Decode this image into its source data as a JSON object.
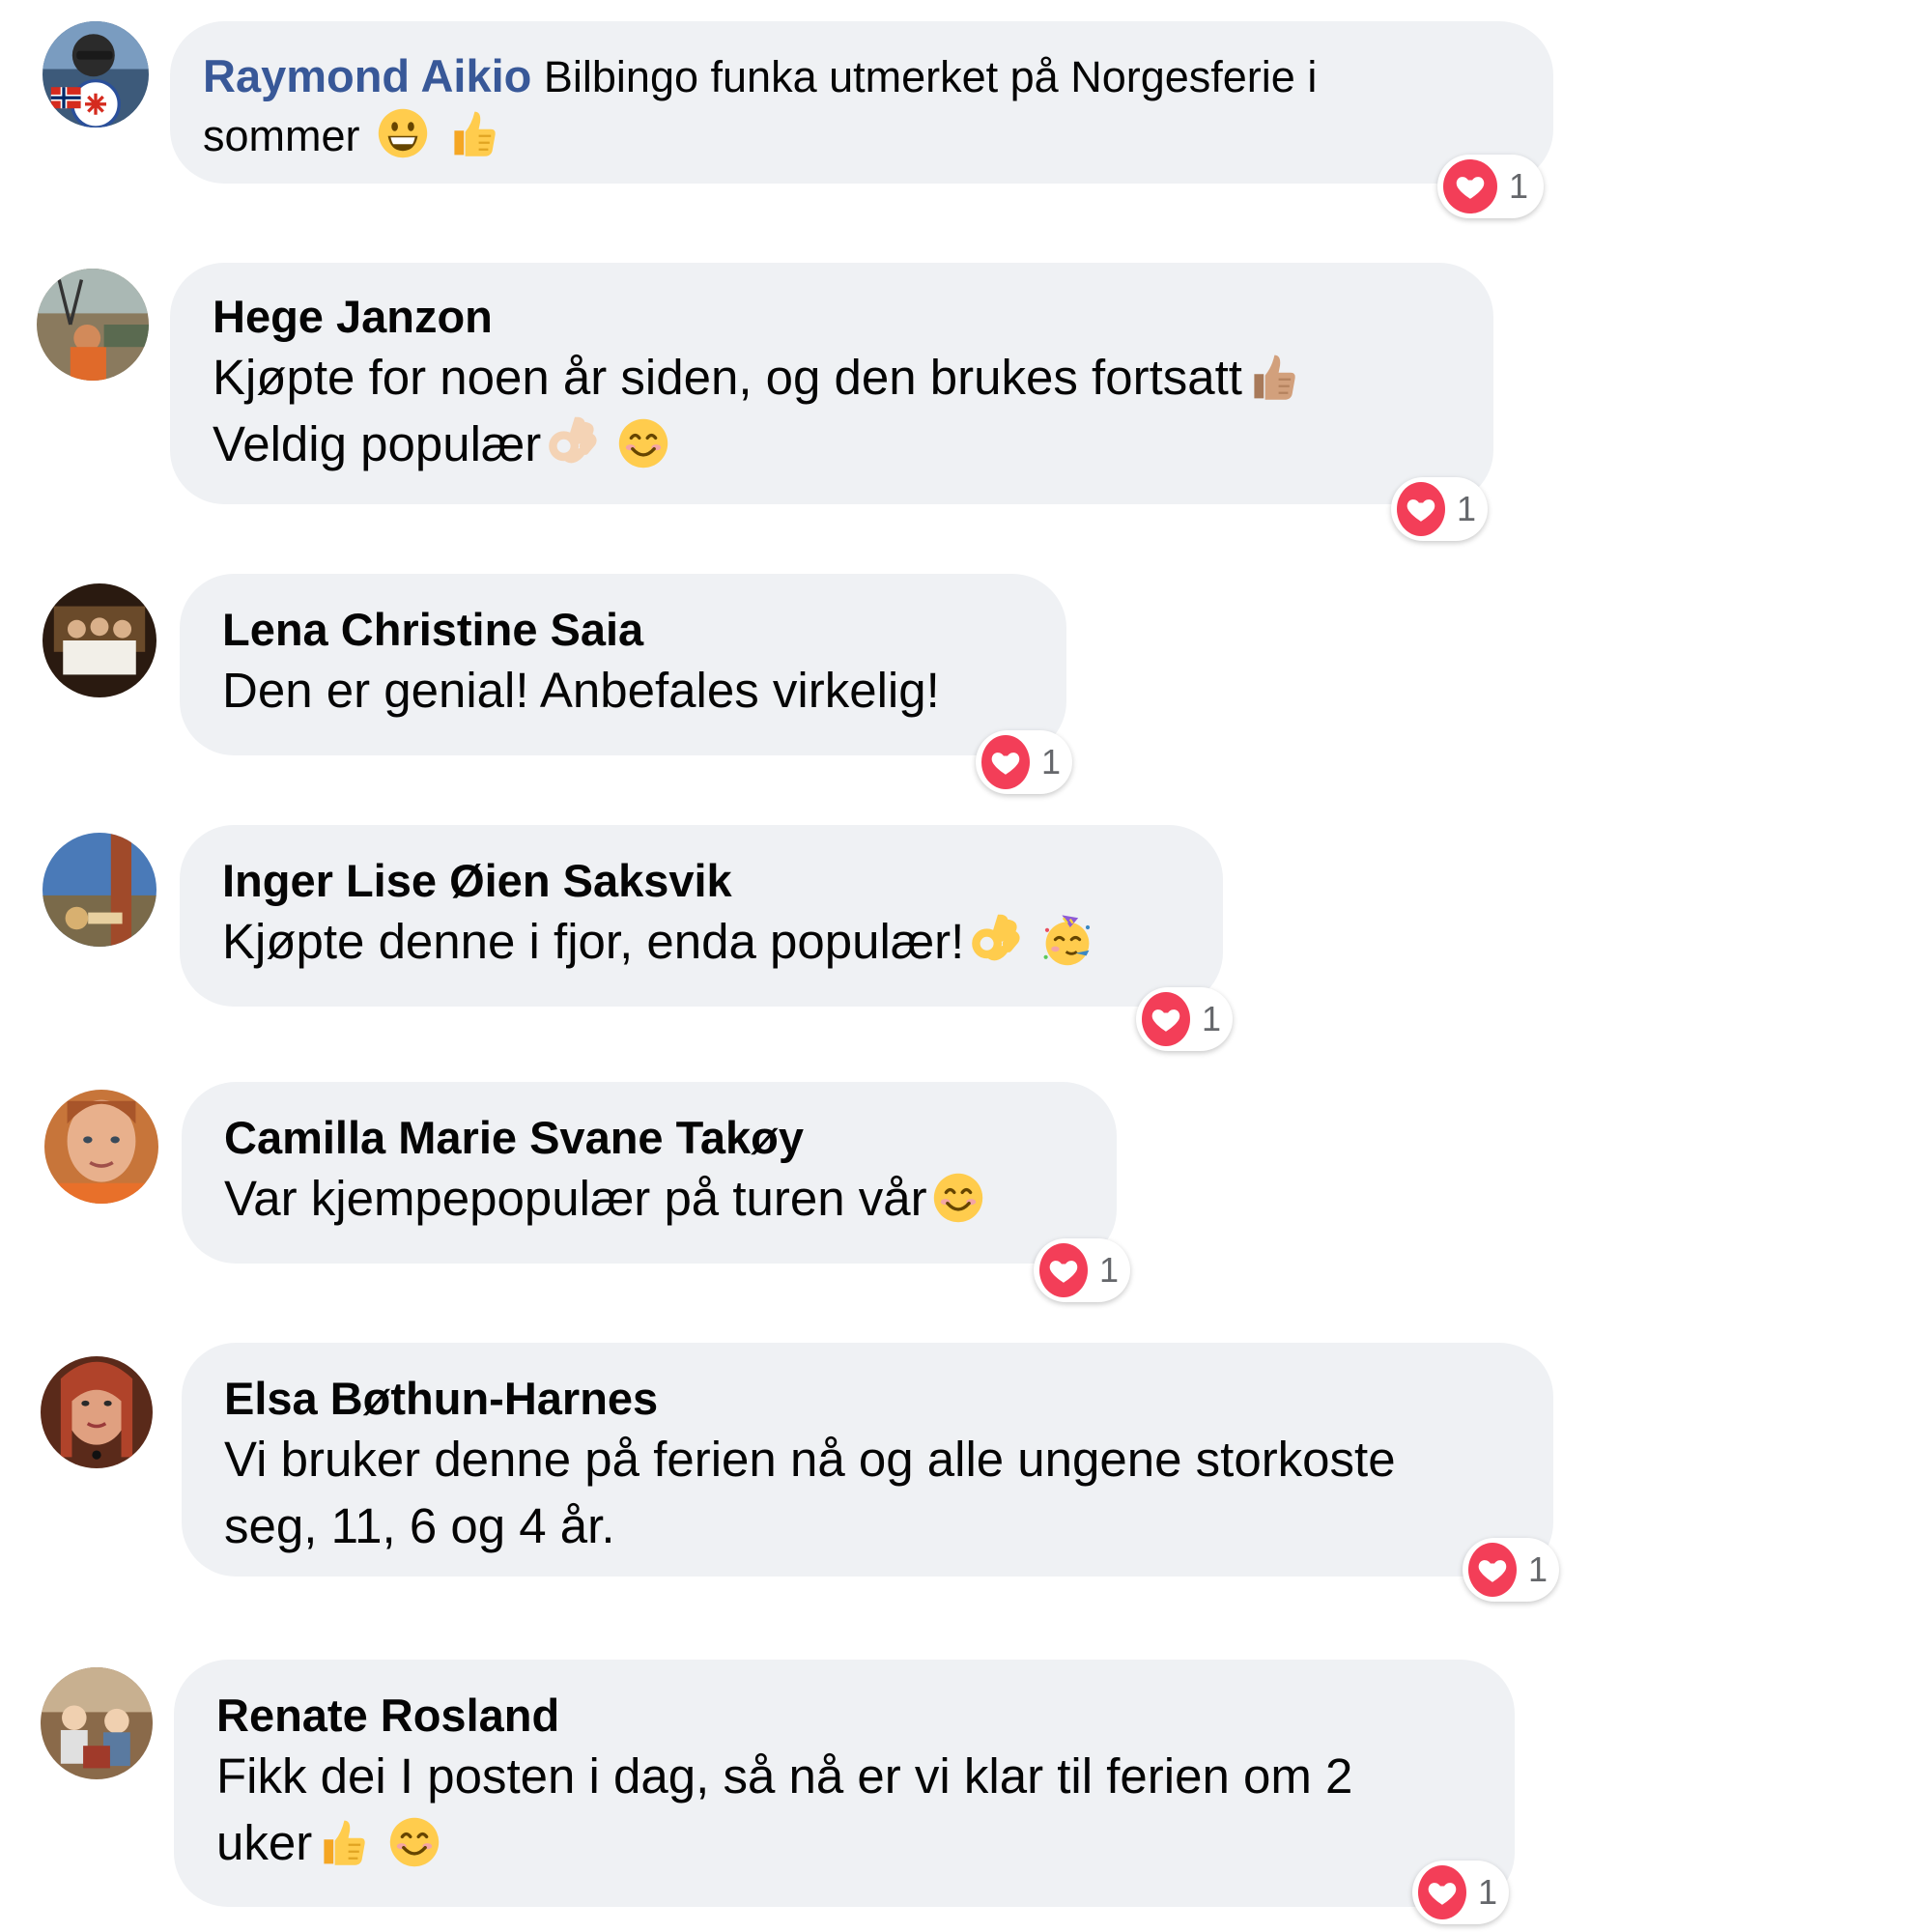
{
  "colors": {
    "bubble": "#eff1f4",
    "link_author": "#385898",
    "heart": "#f33e58",
    "count_text": "#65676b"
  },
  "comments": [
    {
      "author": "Raymond Aikio",
      "text_1": "Bilbingo funka utmerket på Norgesferie i",
      "text_2": "sommer",
      "emojis": [
        "grinning-emoji",
        "thumbs-up-emoji"
      ],
      "reaction": {
        "icon": "heart-icon",
        "count": "1"
      }
    },
    {
      "author": "Hege Janzon",
      "text_1": "Kjøpte for noen år siden, og den brukes fortsatt",
      "text_2": "Veldig populær",
      "emojis": [
        "thumbs-up-medium-skin-emoji",
        "ok-hand-light-skin-emoji",
        "smiling-eyes-emoji"
      ],
      "reaction": {
        "icon": "heart-icon",
        "count": "1"
      }
    },
    {
      "author": "Lena Christine Saia",
      "text_1": "Den er genial! Anbefales virkelig!",
      "reaction": {
        "icon": "heart-icon",
        "count": "1"
      }
    },
    {
      "author": "Inger Lise Øien Saksvik",
      "text_1": "Kjøpte denne i fjor, enda populær!",
      "emojis": [
        "ok-hand-emoji",
        "partying-face-emoji"
      ],
      "reaction": {
        "icon": "heart-icon",
        "count": "1"
      }
    },
    {
      "author": "Camilla Marie Svane Takøy",
      "text_1": "Var kjempepopulær på turen vår",
      "emojis": [
        "smiling-eyes-emoji"
      ],
      "reaction": {
        "icon": "heart-icon",
        "count": "1"
      }
    },
    {
      "author": "Elsa Bøthun-Harnes",
      "text_1": "Vi bruker denne på ferien nå og alle ungene storkoste",
      "text_2": "seg, 11, 6 og 4 år.",
      "reaction": {
        "icon": "heart-icon",
        "count": "1"
      }
    },
    {
      "author": "Renate Rosland",
      "text_1": "Fikk dei I posten i dag, så nå er vi klar til ferien om 2",
      "text_2": "uker",
      "emojis": [
        "thumbs-up-emoji",
        "smiling-eyes-emoji"
      ],
      "reaction": {
        "icon": "heart-icon",
        "count": "1"
      }
    }
  ]
}
